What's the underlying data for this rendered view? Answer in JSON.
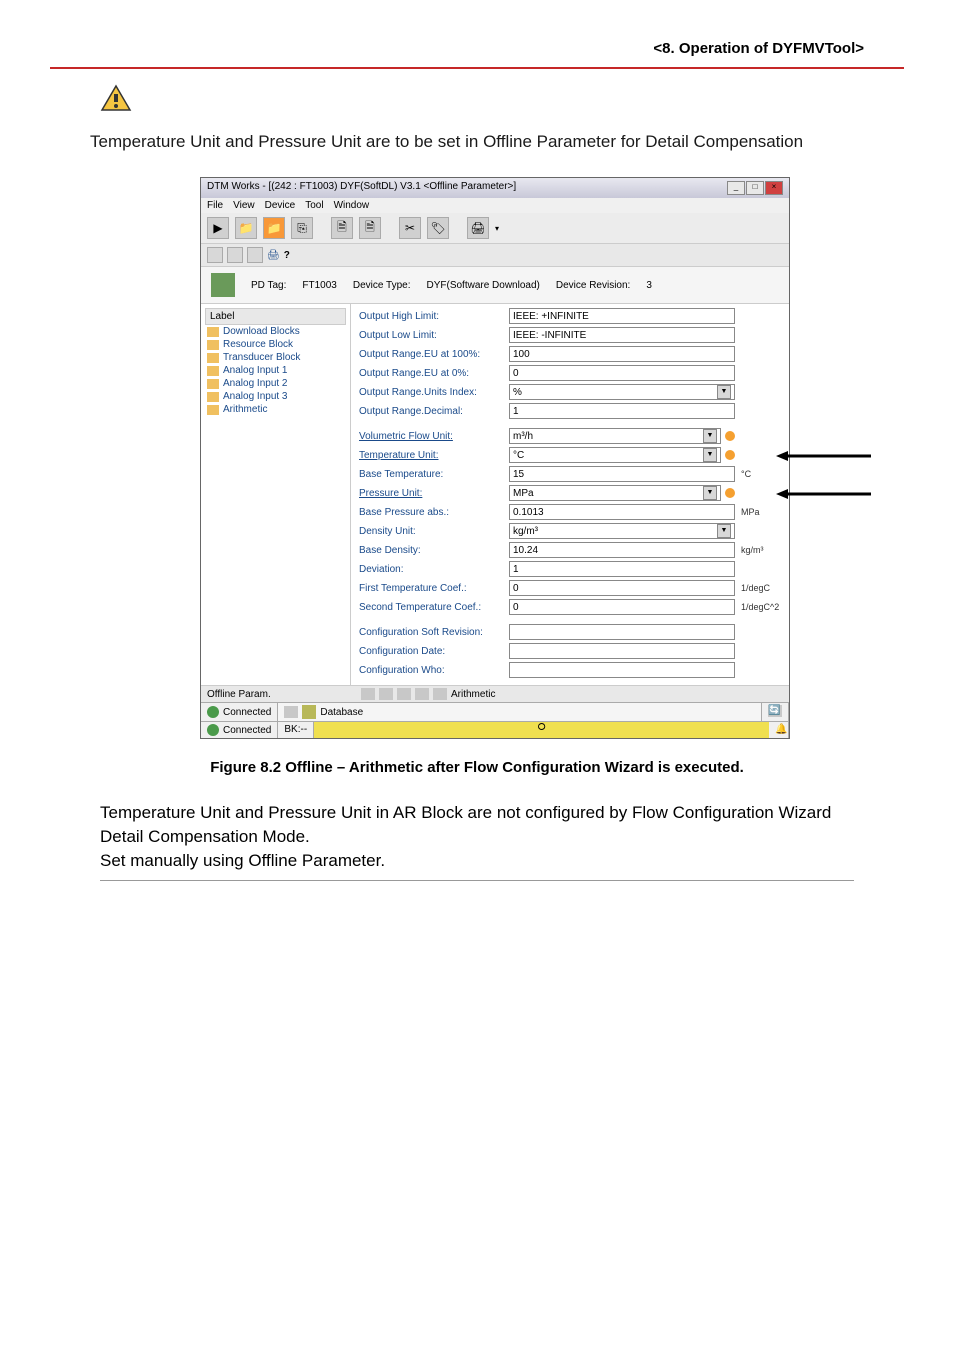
{
  "header": {
    "section_title": "<8.  Operation of DYFMVTool>"
  },
  "intro": "Temperature Unit and Pressure Unit are to be set in Offline Parameter for Detail Compensation",
  "window": {
    "title": "DTM Works - [(242 : FT1003) DYF(SoftDL) V3.1 <Offline Parameter>]",
    "menu": {
      "file": "File",
      "view": "View",
      "device": "Device",
      "tool": "Tool",
      "window": "Window"
    },
    "device_info": {
      "pd_tag_label": "PD Tag:",
      "pd_tag": "FT1003",
      "device_type_label": "Device Type:",
      "device_type": "DYF(Software Download)",
      "device_revision_label": "Device Revision:",
      "device_revision": "3"
    },
    "tree": {
      "header": "Label",
      "items": [
        "Download Blocks",
        "Resource Block",
        "Transducer Block",
        "Analog Input 1",
        "Analog Input 2",
        "Analog Input 3",
        "Arithmetic"
      ]
    },
    "params": {
      "output_high_limit": {
        "label": "Output High Limit:",
        "value": "IEEE: +INFINITE"
      },
      "output_low_limit": {
        "label": "Output Low Limit:",
        "value": "IEEE: -INFINITE"
      },
      "output_range_eu_100": {
        "label": "Output Range.EU at 100%:",
        "value": "100"
      },
      "output_range_eu_0": {
        "label": "Output Range.EU at 0%:",
        "value": "0"
      },
      "output_range_units_index": {
        "label": "Output Range.Units Index:",
        "value": "%"
      },
      "output_range_decimal": {
        "label": "Output Range.Decimal:",
        "value": "1"
      },
      "volumetric_flow_unit": {
        "label": "Volumetric Flow Unit:",
        "value": "m³/h"
      },
      "temperature_unit": {
        "label": "Temperature Unit:",
        "value": "°C"
      },
      "base_temperature": {
        "label": "Base Temperature:",
        "value": "15",
        "unit": "°C"
      },
      "pressure_unit": {
        "label": "Pressure Unit:",
        "value": "MPa"
      },
      "base_pressure_abs": {
        "label": "Base Pressure abs.:",
        "value": "0.1013",
        "unit": "MPa"
      },
      "density_unit": {
        "label": "Density Unit:",
        "value": "kg/m³"
      },
      "base_density": {
        "label": "Base Density:",
        "value": "10.24",
        "unit": "kg/m³"
      },
      "deviation": {
        "label": "Deviation:",
        "value": "1"
      },
      "first_temp_coef": {
        "label": "First Temperature Coef.:",
        "value": "0",
        "unit": "1/degC"
      },
      "second_temp_coef": {
        "label": "Second Temperature Coef.:",
        "value": "0",
        "unit": "1/degC^2"
      },
      "config_soft_revision": {
        "label": "Configuration Soft Revision:",
        "value": ""
      },
      "config_date": {
        "label": "Configuration Date:",
        "value": ""
      },
      "config_who": {
        "label": "Configuration Who:",
        "value": ""
      }
    },
    "bottom_tab": "Offline Param.",
    "tab_label": "Arithmetic",
    "status": {
      "connected1": "Connected",
      "database": "Database",
      "connected2": "Connected",
      "mode": "BK:--"
    }
  },
  "figure_caption": "Figure 8.2   Offline – Arithmetic after Flow Configuration Wizard is executed.",
  "body_text": "Temperature Unit and Pressure Unit in AR Block are not configured by Flow Configuration Wizard Detail Compensation Mode.\nSet manually using Offline Parameter."
}
